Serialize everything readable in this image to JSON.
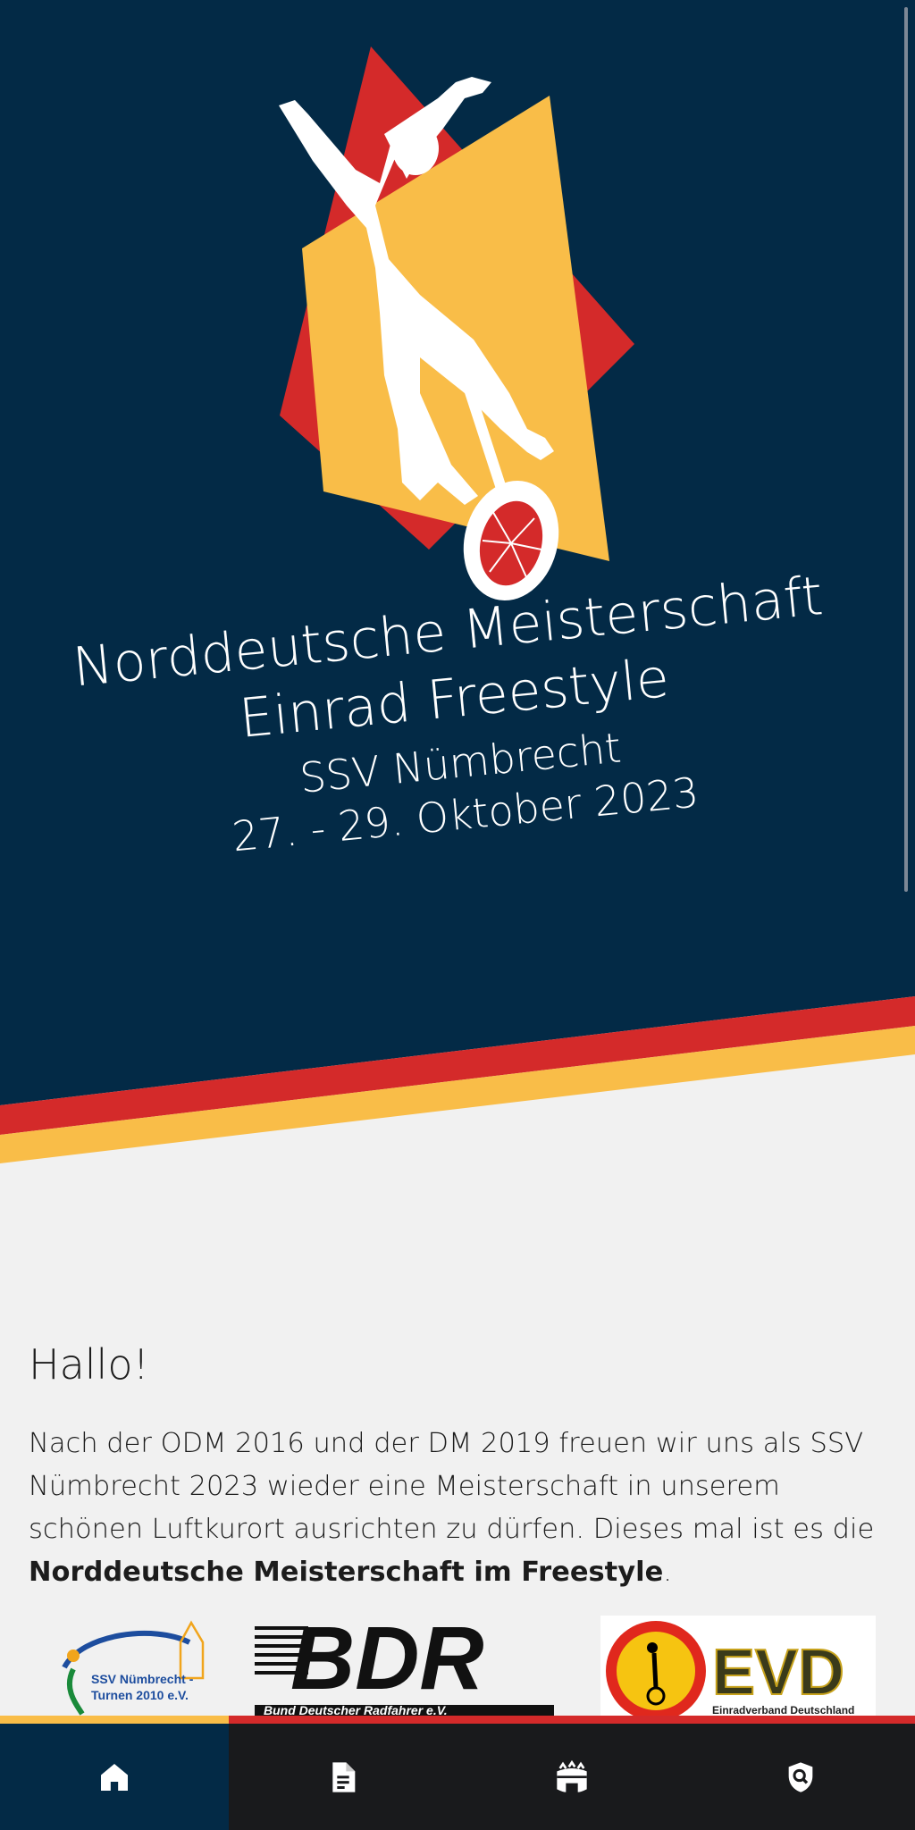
{
  "hero": {
    "title_line1": "Norddeutsche Meisterschaft",
    "title_line2": "Einrad Freestyle",
    "host": "SSV Nümbrecht",
    "dates": "27. - 29. Oktober 2023",
    "colors": {
      "navy": "#032a46",
      "red": "#d42a2a",
      "yellow": "#f9bd48"
    }
  },
  "content": {
    "greeting": "Hallo!",
    "intro_text": "Nach der ODM 2016 und der DM 2019 freuen wir uns als SSV Nümbrecht 2023 wieder eine Meisterschaft in unserem schönen Luftkurort ausrichten zu dürfen. Dieses mal ist es die ",
    "intro_bold": "Norddeutsche Meisterschaft im Freestyle",
    "intro_end": "."
  },
  "sponsors": {
    "ssv": {
      "line1": "SSV Nümbrecht -",
      "line2": "Turnen 2010 e.V."
    },
    "bdr": {
      "mark": "BDR",
      "caption": "Bund Deutscher Radfahrer e.V."
    },
    "evd": {
      "mark": "EVD",
      "caption": "Einradverband Deutschland"
    }
  },
  "tabbar": {
    "active_index": 0,
    "tabs": [
      {
        "icon": "home-icon"
      },
      {
        "icon": "document-icon"
      },
      {
        "icon": "arena-icon"
      },
      {
        "icon": "shield-search-icon"
      }
    ]
  }
}
